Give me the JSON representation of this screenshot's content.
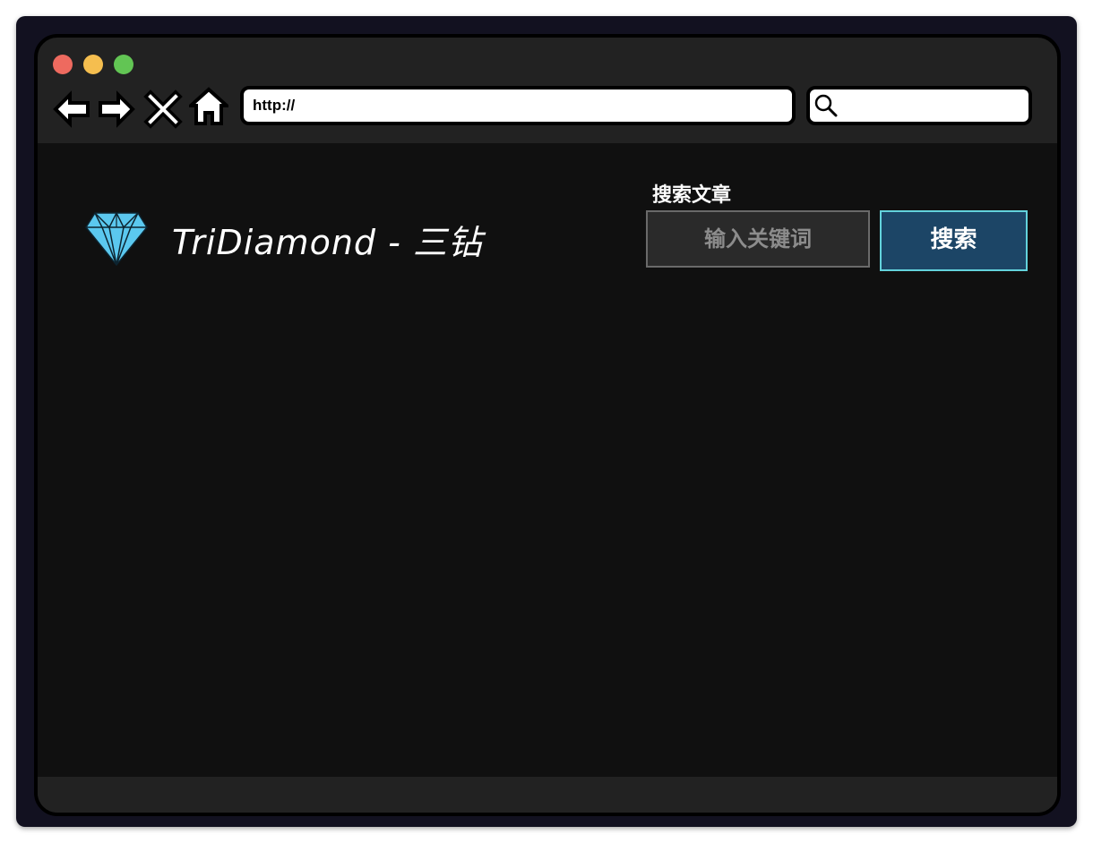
{
  "browser": {
    "traffic_lights": {
      "close_color": "#ee6a5f",
      "minimize_color": "#f5be4f",
      "maximize_color": "#62c554"
    },
    "nav_icons": [
      "back-arrow-icon",
      "forward-arrow-icon",
      "stop-icon",
      "home-icon"
    ],
    "url": "http://",
    "search_icon": "magnifier-icon"
  },
  "page": {
    "logo_icon": "diamond-icon",
    "logo_color": "#5bc8ef",
    "site_title": "TriDiamond - 三钻",
    "search": {
      "label": "搜索文章",
      "placeholder": "输入关键词",
      "button_label": "搜索",
      "button_color": "#1c4566",
      "button_border_color": "#63d2dc"
    }
  }
}
